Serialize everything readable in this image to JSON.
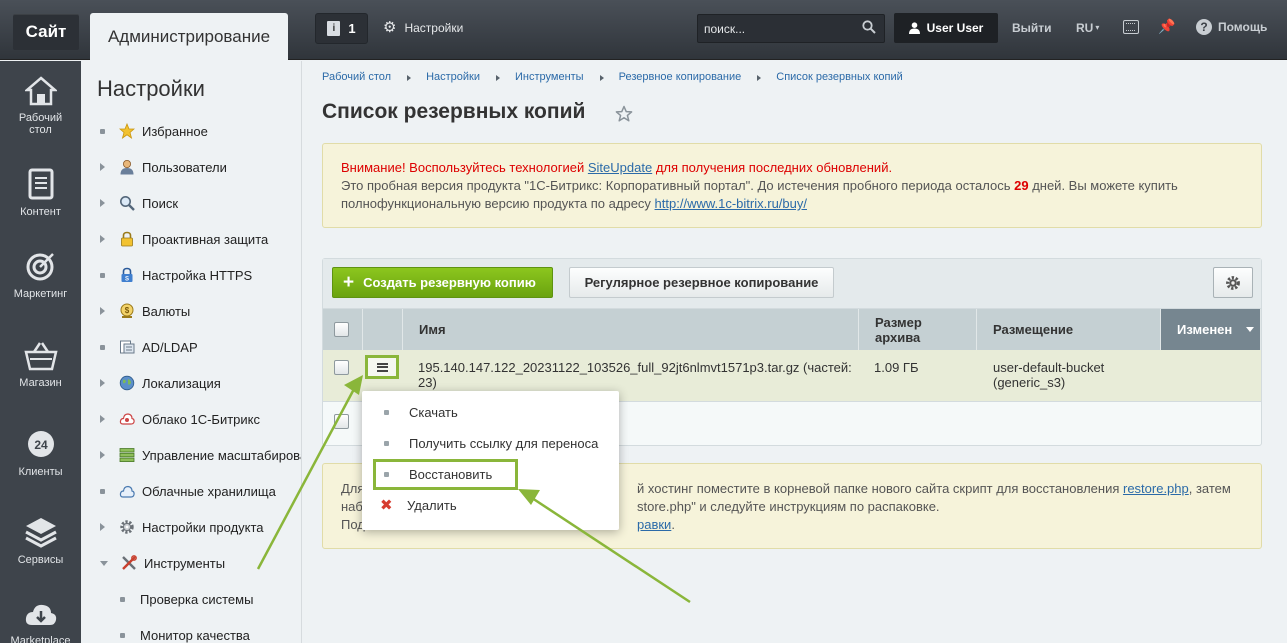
{
  "topbar": {
    "site_label": "Сайт",
    "admin_label": "Администрирование",
    "notifications_count": "1",
    "notifications_icon": "i",
    "settings_label": "Настройки",
    "search_placeholder": "поиск...",
    "user_label": "User User",
    "logout_label": "Выйти",
    "lang_label": "RU",
    "help_label": "Помощь"
  },
  "rail": [
    {
      "label_line1": "Рабочий",
      "label_line2": "стол",
      "icon": "home-icon"
    },
    {
      "label_line1": "Контент",
      "label_line2": "",
      "icon": "document-icon"
    },
    {
      "label_line1": "Маркетинг",
      "label_line2": "",
      "icon": "target-icon"
    },
    {
      "label_line1": "Магазин",
      "label_line2": "",
      "icon": "basket-icon"
    },
    {
      "label_line1": "Клиенты",
      "label_line2": "",
      "icon": "clients-24-icon",
      "badge": "24"
    },
    {
      "label_line1": "Сервисы",
      "label_line2": "",
      "icon": "layers-icon"
    },
    {
      "label_line1": "Marketplace",
      "label_line2": "",
      "icon": "cloud-download-icon"
    }
  ],
  "sidebar": {
    "title": "Настройки",
    "items": [
      {
        "label": "Избранное",
        "marker": "bullet",
        "icon": "star-icon"
      },
      {
        "label": "Пользователи",
        "marker": "arrow",
        "icon": "user-icon"
      },
      {
        "label": "Поиск",
        "marker": "arrow",
        "icon": "search-icon"
      },
      {
        "label": "Проактивная защита",
        "marker": "arrow",
        "icon": "lock-icon"
      },
      {
        "label": "Настройка HTTPS",
        "marker": "bullet",
        "icon": "https-lock-icon"
      },
      {
        "label": "Валюты",
        "marker": "arrow",
        "icon": "currency-icon"
      },
      {
        "label": "AD/LDAP",
        "marker": "bullet",
        "icon": "ldap-icon"
      },
      {
        "label": "Локализация",
        "marker": "arrow",
        "icon": "globe-icon"
      },
      {
        "label": "Облако 1С-Битрикс",
        "marker": "arrow",
        "icon": "bitrix-cloud-icon"
      },
      {
        "label": "Управление масштабирова",
        "marker": "arrow",
        "icon": "servers-icon"
      },
      {
        "label": "Облачные хранилища",
        "marker": "bullet",
        "icon": "cloud-storage-icon"
      },
      {
        "label": "Настройки продукта",
        "marker": "arrow",
        "icon": "gear-icon"
      },
      {
        "label": "Инструменты",
        "marker": "arrow-down",
        "icon": "tools-icon"
      },
      {
        "label": "Проверка системы",
        "marker": "sub-bullet",
        "icon": ""
      },
      {
        "label": "Монитор качества",
        "marker": "sub-bullet",
        "icon": ""
      }
    ]
  },
  "breadcrumbs": [
    "Рабочий стол",
    "Настройки",
    "Инструменты",
    "Резервное копирование",
    "Список резервных копий"
  ],
  "page_title": "Список резервных копий",
  "alert": {
    "warn_prefix": "Внимание! Воспользуйтесь технологией ",
    "warn_link": "SiteUpdate",
    "warn_suffix": " для получения последних обновлений.",
    "trial_prefix": "Это пробная версия продукта \"1С-Битрикс: Корпоративный портал\". До истечения пробного периода осталось ",
    "trial_days": "29",
    "trial_suffix": " дней. Вы можете купить",
    "buy_prefix": "полнофункциональную версию продукта по адресу ",
    "buy_link": "http://www.1c-bitrix.ru/buy/"
  },
  "toolbar": {
    "create_label": "Создать резервную копию",
    "regular_label": "Регулярное резервное копирование"
  },
  "table": {
    "col_name": "Имя",
    "col_size_line1": "Размер",
    "col_size_line2": "архива",
    "col_location": "Размещение",
    "col_modified": "Изменен",
    "row": {
      "name_line1": "195.140.147.122_20231122_103526_full_92jt6nlmvt1571p3.tar.gz (частей:",
      "name_line2": "23)",
      "size": "1.09 ГБ",
      "location_line1": "user-default-bucket",
      "location_line2": "(generic_s3)"
    }
  },
  "help_panel": {
    "line1_prefix": "Для",
    "line1_suffix": "й хостинг поместите в корневой папке нового сайта скрипт для восстановления ",
    "line1_link": "restore.php",
    "line1_end": ", затем",
    "line2_prefix": "наб",
    "line2_suffix": "store.php\" и следуйте инструкциям по распаковке.",
    "line3_prefix": "Под",
    "line3_link": "равки",
    "line3_end": "."
  },
  "context_menu": {
    "items": [
      {
        "label": "Скачать"
      },
      {
        "label": "Получить ссылку для переноса"
      },
      {
        "label": "Восстановить"
      },
      {
        "label": "Удалить"
      }
    ]
  },
  "colors": {
    "accent_green": "#8ab63a",
    "create_button": "#7bb51a",
    "warning_red": "#dd0000",
    "link_blue": "#2b6aa8",
    "rail_bg": "#3e444b"
  }
}
